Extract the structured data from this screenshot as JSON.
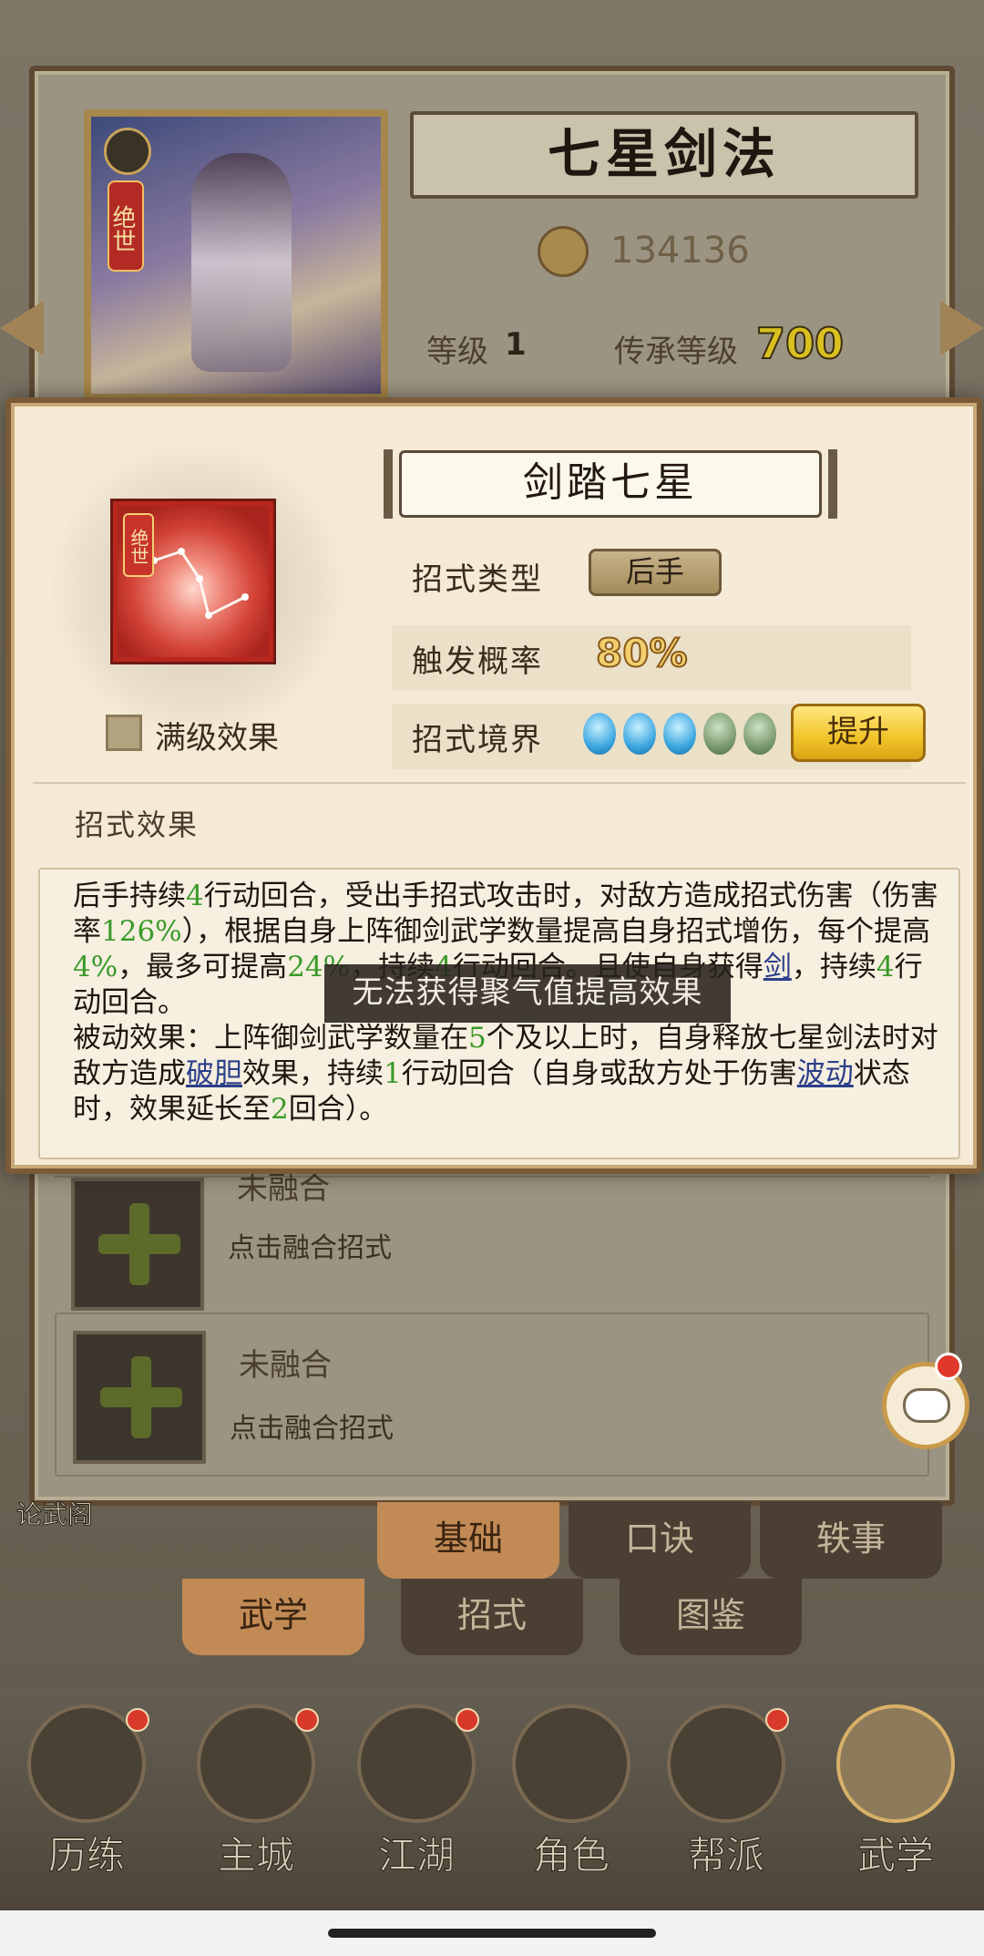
{
  "background": {
    "skill_title": "七星剑法",
    "power": "134136",
    "level_label": "等级",
    "level_value": "1",
    "inherit_label": "传承等级",
    "inherit_value": "700",
    "card_seal": "绝世",
    "fusion_slots": [
      {
        "title": "未融合",
        "hint": "点击融合招式"
      },
      {
        "title": "未融合",
        "hint": "点击融合招式"
      }
    ],
    "side_label": "论武阁",
    "tabs_top": [
      "基础",
      "口诀",
      "轶事"
    ],
    "tabs_bottom": [
      "武学",
      "招式",
      "图鉴"
    ],
    "nav": [
      "历练",
      "主城",
      "江湖",
      "角色",
      "帮派",
      "武学"
    ]
  },
  "modal": {
    "icon_tag": "绝世",
    "title": "剑踏七星",
    "max_level_label": "满级效果",
    "type_label": "招式类型",
    "type_value": "后手",
    "trigger_label": "触发概率",
    "trigger_value": "80%",
    "realm_label": "招式境界",
    "realm_level": 3,
    "realm_max": 5,
    "upgrade_label": "提升",
    "effect_heading": "招式效果"
  },
  "toast": "无法获得聚气值提高效果",
  "colors": {
    "accent_gold": "#f1c42a",
    "number_green": "#3a9a2a",
    "link_blue": "#2b3f8a"
  }
}
